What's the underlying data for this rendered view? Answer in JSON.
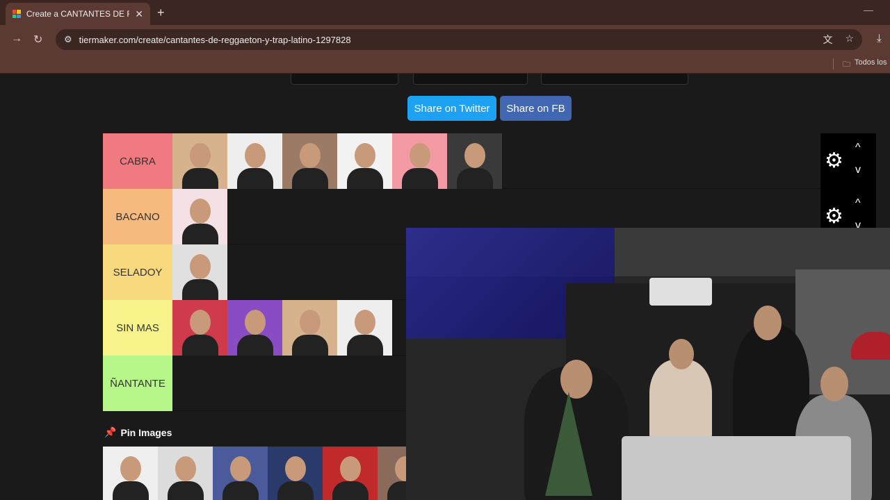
{
  "browser": {
    "tab_title": "Create a CANTANTES DE REGGAETON",
    "tab_close": "✕",
    "new_tab": "+",
    "url": "tiermaker.com/create/cantantes-de-reggaeton-y-trap-latino-1297828",
    "bookmark_folder": "Todos los",
    "icons": {
      "back": "→",
      "reload": "↻",
      "site_settings": "⚙",
      "translate": "文",
      "star": "☆",
      "download": "⤓",
      "folder": "🗀",
      "minimize": "—"
    }
  },
  "share": {
    "twitter": "Share on Twitter",
    "facebook": "Share on FB"
  },
  "tiers": [
    {
      "label": "CABRA",
      "color": "#f07a80",
      "count": 6
    },
    {
      "label": "BACANO",
      "color": "#f6b97e",
      "count": 1
    },
    {
      "label": "SELADOY",
      "color": "#f9d97e",
      "count": 1
    },
    {
      "label": "SIN MAS",
      "color": "#f8f28a",
      "count": 4
    },
    {
      "label": "ÑANTANTE",
      "color": "#b7f78a",
      "count": 0
    }
  ],
  "tier_controls": {
    "gear": "⚙",
    "up": "^",
    "down": "v"
  },
  "pin": {
    "icon": "📌",
    "label": "Pin Images"
  }
}
